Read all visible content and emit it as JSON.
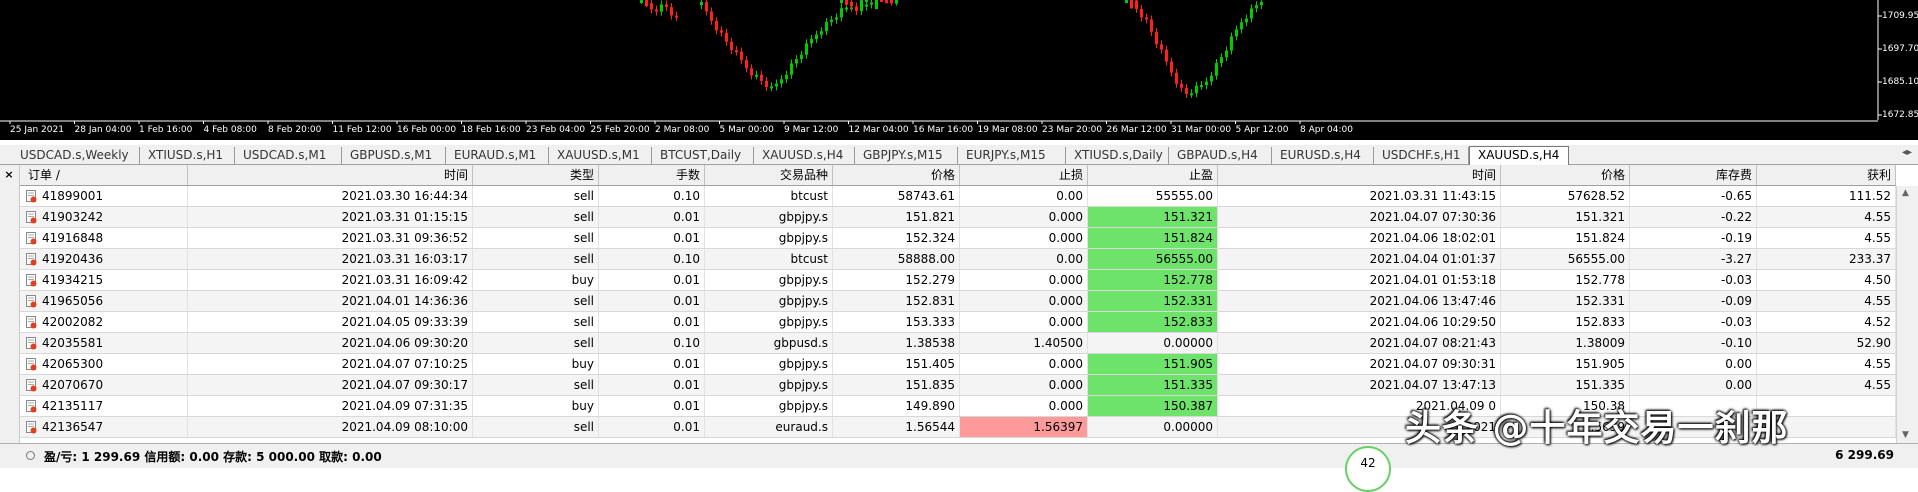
{
  "chart": {
    "price_labels": [
      "1709.95",
      "1697.70",
      "1685.10",
      "1672.85"
    ],
    "time_labels": [
      "25 Jan 2021",
      "28 Jan 04:00",
      "1 Feb 16:00",
      "4 Feb 08:00",
      "8 Feb 20:00",
      "11 Feb 12:00",
      "16 Feb 00:00",
      "18 Feb 16:00",
      "23 Feb 04:00",
      "25 Feb 20:00",
      "2 Mar 08:00",
      "5 Mar 00:00",
      "9 Mar 12:00",
      "12 Mar 04:00",
      "16 Mar 16:00",
      "19 Mar 08:00",
      "23 Mar 20:00",
      "26 Mar 12:00",
      "31 Mar 00:00",
      "5 Apr 12:00",
      "8 Apr 04:00"
    ],
    "colors": {
      "bull": "#00cc00",
      "bear": "#ff2020",
      "background": "#000000"
    }
  },
  "tabs": [
    "USDCAD.s,Weekly",
    "XTIUSD.s,H1",
    "USDCAD.s,M1",
    "GBPUSD.s,M1",
    "EURAUD.s,M1",
    "XAUUSD.s,M1",
    "BTCUST,Daily",
    "XAUUSD.s,H4",
    "GBPJPY.s,M15",
    "EURJPY.s,M15",
    "XTIUSD.s,Daily",
    "GBPAUD.s,H4",
    "EURUSD.s,H4",
    "USDCHF.s,H1",
    "XAUUSD.s,H4"
  ],
  "active_tab_index": 14,
  "terminal": {
    "close_icon": "×",
    "headers": [
      "订单 /",
      "时间",
      "类型",
      "手数",
      "交易品种",
      "价格",
      "止损",
      "止盈",
      "时间",
      "价格",
      "库存费",
      "获利"
    ],
    "rows": [
      {
        "order": "41899001",
        "open_time": "2021.03.30 16:44:34",
        "type": "sell",
        "lots": "0.10",
        "symbol": "btcust",
        "price": "58743.61",
        "sl": "0.00",
        "tp": "55555.00",
        "close_time": "2021.03.31 11:43:15",
        "close_price": "57628.52",
        "swap": "-0.65",
        "profit": "111.52",
        "hit": "none"
      },
      {
        "order": "41903242",
        "open_time": "2021.03.31 01:15:15",
        "type": "sell",
        "lots": "0.01",
        "symbol": "gbpjpy.s",
        "price": "151.821",
        "sl": "0.000",
        "tp": "151.321",
        "close_time": "2021.04.07 07:30:36",
        "close_price": "151.321",
        "swap": "-0.22",
        "profit": "4.55",
        "hit": "tp"
      },
      {
        "order": "41916848",
        "open_time": "2021.03.31 09:36:52",
        "type": "sell",
        "lots": "0.01",
        "symbol": "gbpjpy.s",
        "price": "152.324",
        "sl": "0.000",
        "tp": "151.824",
        "close_time": "2021.04.06 18:02:01",
        "close_price": "151.824",
        "swap": "-0.19",
        "profit": "4.55",
        "hit": "tp"
      },
      {
        "order": "41920436",
        "open_time": "2021.03.31 16:03:17",
        "type": "sell",
        "lots": "0.10",
        "symbol": "btcust",
        "price": "58888.00",
        "sl": "0.00",
        "tp": "56555.00",
        "close_time": "2021.04.04 01:01:37",
        "close_price": "56555.00",
        "swap": "-3.27",
        "profit": "233.37",
        "hit": "tp"
      },
      {
        "order": "41934215",
        "open_time": "2021.03.31 16:09:42",
        "type": "buy",
        "lots": "0.01",
        "symbol": "gbpjpy.s",
        "price": "152.279",
        "sl": "0.000",
        "tp": "152.778",
        "close_time": "2021.04.01 01:53:18",
        "close_price": "152.778",
        "swap": "-0.03",
        "profit": "4.50",
        "hit": "tp"
      },
      {
        "order": "41965056",
        "open_time": "2021.04.01 14:36:36",
        "type": "sell",
        "lots": "0.01",
        "symbol": "gbpjpy.s",
        "price": "152.831",
        "sl": "0.000",
        "tp": "152.331",
        "close_time": "2021.04.06 13:47:46",
        "close_price": "152.331",
        "swap": "-0.09",
        "profit": "4.55",
        "hit": "tp"
      },
      {
        "order": "42002082",
        "open_time": "2021.04.05 09:33:39",
        "type": "sell",
        "lots": "0.01",
        "symbol": "gbpjpy.s",
        "price": "153.333",
        "sl": "0.000",
        "tp": "152.833",
        "close_time": "2021.04.06 10:29:50",
        "close_price": "152.833",
        "swap": "-0.03",
        "profit": "4.52",
        "hit": "tp"
      },
      {
        "order": "42035581",
        "open_time": "2021.04.06 09:30:20",
        "type": "sell",
        "lots": "0.10",
        "symbol": "gbpusd.s",
        "price": "1.38538",
        "sl": "1.40500",
        "tp": "0.00000",
        "close_time": "2021.04.07 08:21:43",
        "close_price": "1.38009",
        "swap": "-0.10",
        "profit": "52.90",
        "hit": "none"
      },
      {
        "order": "42065300",
        "open_time": "2021.04.07 07:10:25",
        "type": "buy",
        "lots": "0.01",
        "symbol": "gbpjpy.s",
        "price": "151.405",
        "sl": "0.000",
        "tp": "151.905",
        "close_time": "2021.04.07 09:30:31",
        "close_price": "151.905",
        "swap": "0.00",
        "profit": "4.55",
        "hit": "tp"
      },
      {
        "order": "42070670",
        "open_time": "2021.04.07 09:30:17",
        "type": "sell",
        "lots": "0.01",
        "symbol": "gbpjpy.s",
        "price": "151.835",
        "sl": "0.000",
        "tp": "151.335",
        "close_time": "2021.04.07 13:47:13",
        "close_price": "151.335",
        "swap": "0.00",
        "profit": "4.55",
        "hit": "tp"
      },
      {
        "order": "42135117",
        "open_time": "2021.04.09 07:31:35",
        "type": "buy",
        "lots": "0.01",
        "symbol": "gbpjpy.s",
        "price": "149.890",
        "sl": "0.000",
        "tp": "150.387",
        "close_time": "2021.04.09 0",
        "close_price": "150.38",
        "swap": "",
        "profit": "",
        "hit": "tp"
      },
      {
        "order": "42136547",
        "open_time": "2021.04.09 08:10:00",
        "type": "sell",
        "lots": "0.01",
        "symbol": "euraud.s",
        "price": "1.56544",
        "sl": "1.56397",
        "tp": "0.00000",
        "close_time": "2021",
        "close_price": "1.5639",
        "swap": "",
        "profit": "",
        "hit": "sl"
      }
    ],
    "footer": {
      "summary": "盈/亏: 1 299.69  信用额: 0.00  存款: 5 000.00  取款: 0.00",
      "total_profit": "6 299.69"
    }
  },
  "watermark": {
    "text": "头条 @十年交易一刹那",
    "badge": "42"
  }
}
